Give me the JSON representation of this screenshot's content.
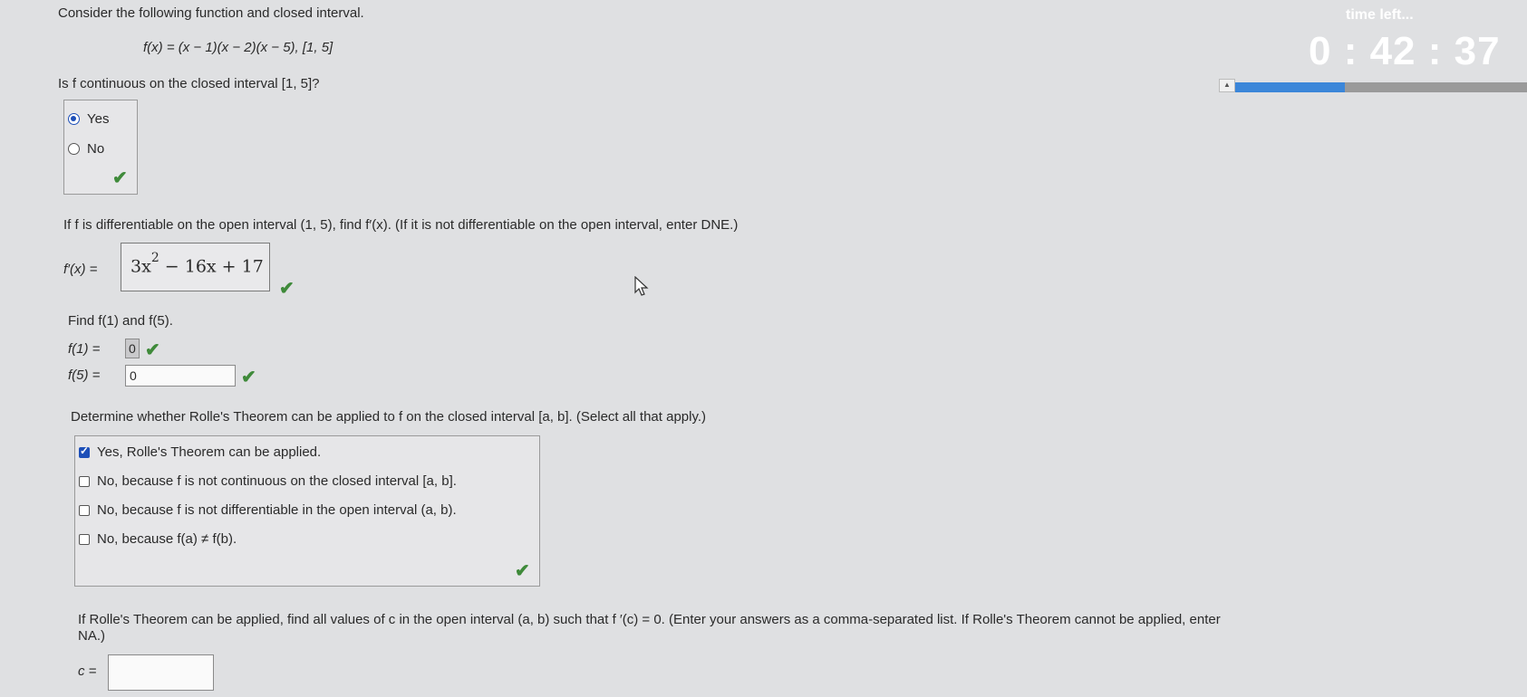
{
  "header": {
    "intro": "Consider the following function and closed interval.",
    "function": "f(x) = (x − 1)(x − 2)(x − 5),    [1, 5]"
  },
  "timer": {
    "label": "time left...",
    "value": "0 : 42 : 37",
    "progress_fraction": 0.41
  },
  "q1": {
    "prompt": "Is f continuous on the closed interval [1, 5]?",
    "options": [
      "Yes",
      "No"
    ],
    "selected": "Yes"
  },
  "q2": {
    "prompt": "If f is differentiable on the open interval (1, 5), find f′(x). (If it is not differentiable on the open interval, enter DNE.)",
    "label": "f′(x) =",
    "answer_part1": "3x",
    "answer_exp": "2",
    "answer_part2": " − 16x + 17"
  },
  "q3": {
    "prompt": "Find f(1) and f(5).",
    "f1_label": "f(1)  =",
    "f1_value": "0",
    "f5_label": "f(5)  =",
    "f5_value": "0"
  },
  "q4": {
    "prompt": "Determine whether Rolle's Theorem can be applied to f on the closed interval [a, b]. (Select all that apply.)",
    "options": [
      "Yes, Rolle's Theorem can be applied.",
      "No, because f is not continuous on the closed interval [a, b].",
      "No, because f is not differentiable in the open interval (a, b).",
      "No, because f(a) ≠ f(b)."
    ],
    "checked": [
      true,
      false,
      false,
      false
    ]
  },
  "q5": {
    "prompt_line1": "If Rolle's Theorem can be applied, find all values of c in the open interval (a, b) such that f ′(c) = 0. (Enter your answers as a comma-separated list. If Rolle's Theorem cannot be applied, enter",
    "prompt_line2": "NA.)",
    "label": "c =",
    "value": ""
  },
  "colors": {
    "background": "#dfe0e2",
    "correct_check": "#3f8a3a",
    "selected_blue": "#1d4fb8",
    "timer_bar": "#3b86d9"
  }
}
